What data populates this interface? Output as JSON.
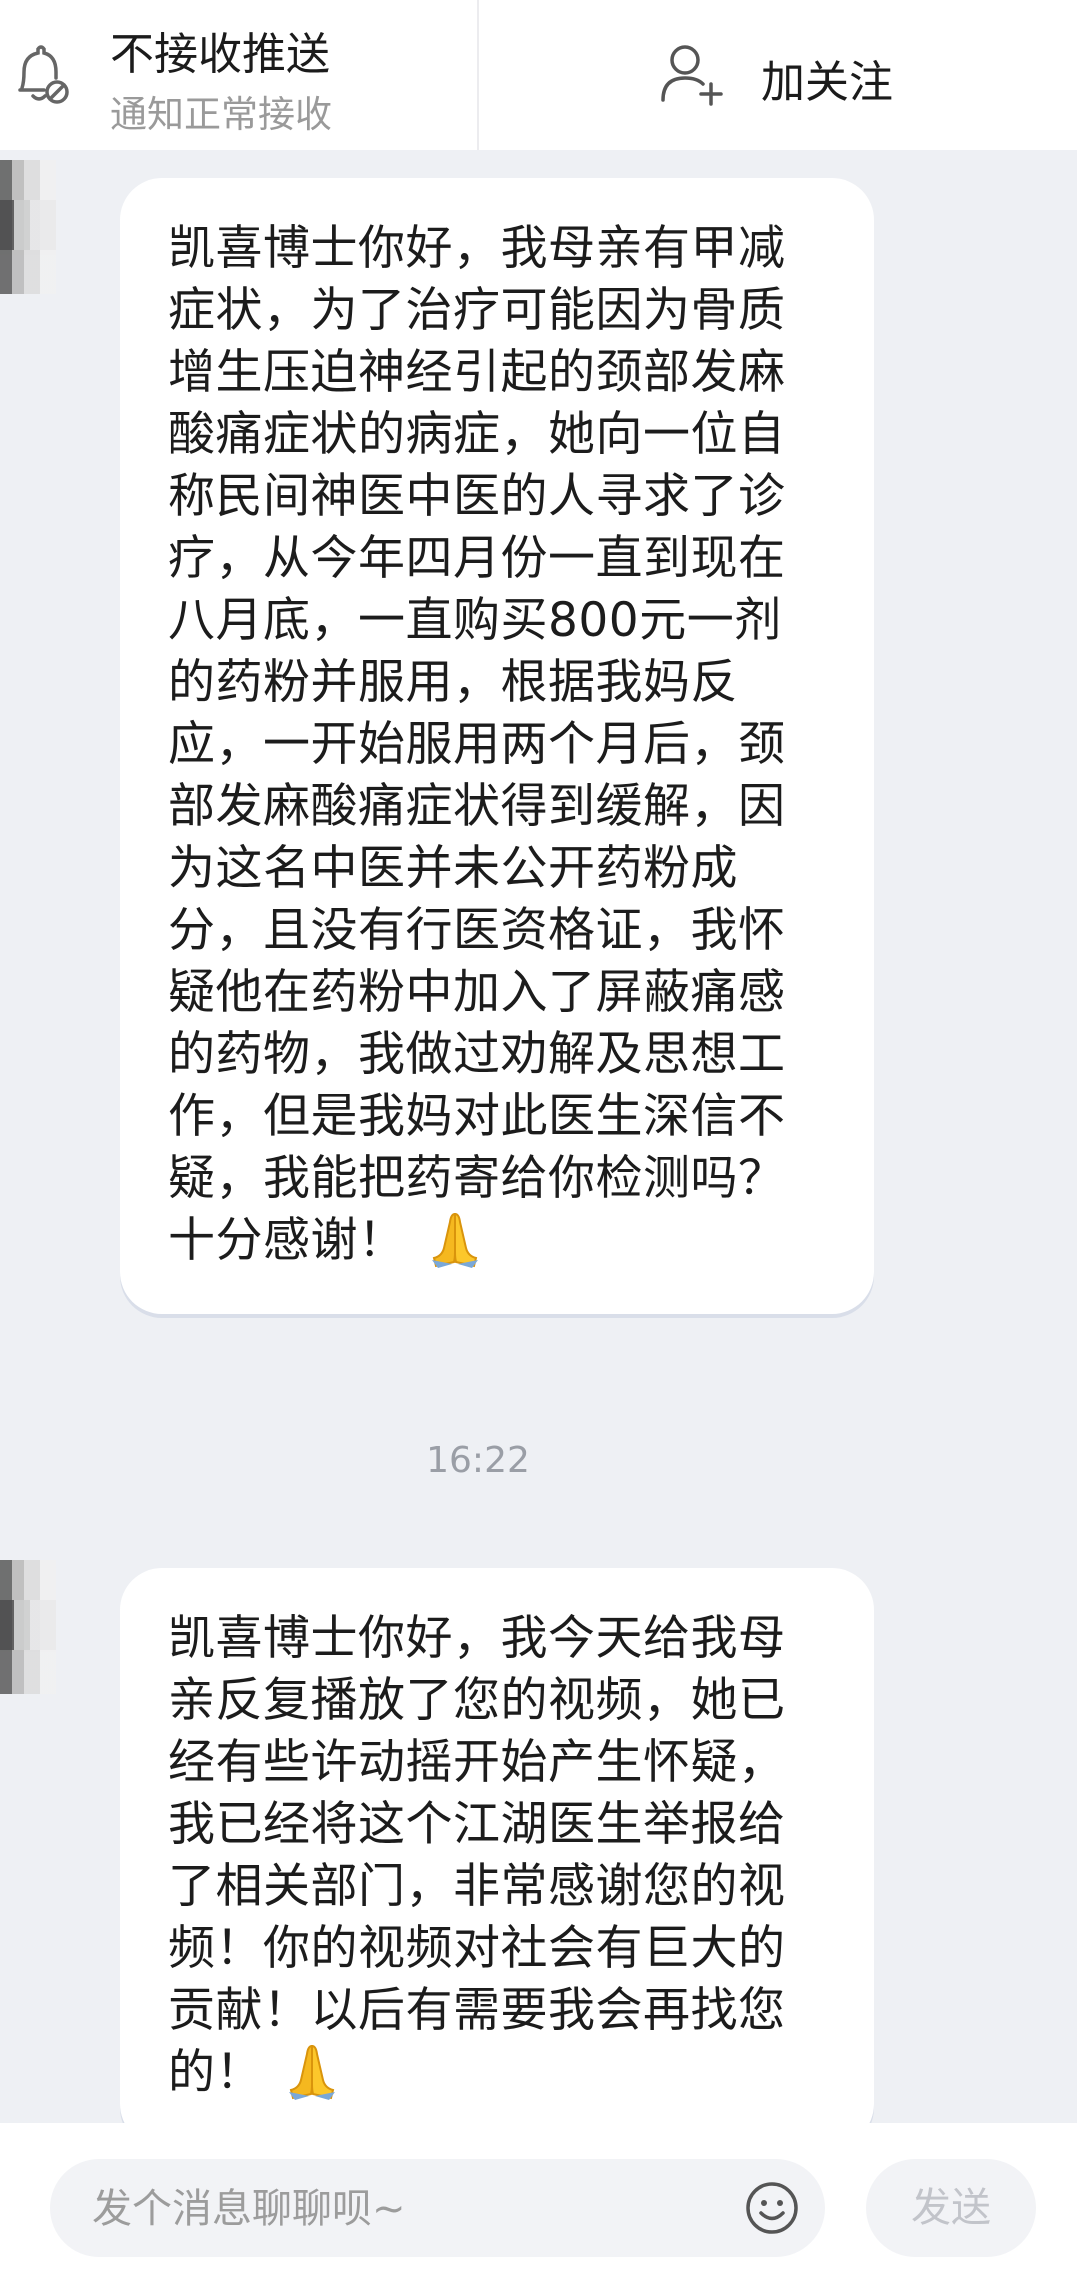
{
  "header": {
    "push_title": "不接收推送",
    "push_subtitle": "通知正常接收",
    "follow_label": "加关注"
  },
  "messages": [
    {
      "text": "凯喜博士你好，我母亲有甲减症状，为了治疗可能因为骨质增生压迫神经引起的颈部发麻酸痛症状的病症，她向一位自称民间神医中医的人寻求了诊疗，从今年四月份一直到现在八月底，一直购买800元一剂的药粉并服用，根据我妈反应，一开始服用两个月后，颈部发麻酸痛症状得到缓解，因为这名中医并未公开药粉成分，且没有行医资格证，我怀疑他在药粉中加入了屏蔽痛感的药物，我做过劝解及思想工作，但是我妈对此医生深信不疑，我能把药寄给你检测吗？十分感谢！",
      "emoji": "folded-hands"
    },
    {
      "text": "凯喜博士你好，我今天给我母亲反复播放了您的视频，她已经有些许动摇开始产生怀疑，我已经将这个江湖医生举报给了相关部门，非常感谢您的视频！你的视频对社会有巨大的贡献！以后有需要我会再找您的！",
      "emoji": "folded-hands"
    }
  ],
  "timestamp": "16:22",
  "composer": {
    "placeholder": "发个消息聊聊呗~",
    "send_label": "发送"
  }
}
